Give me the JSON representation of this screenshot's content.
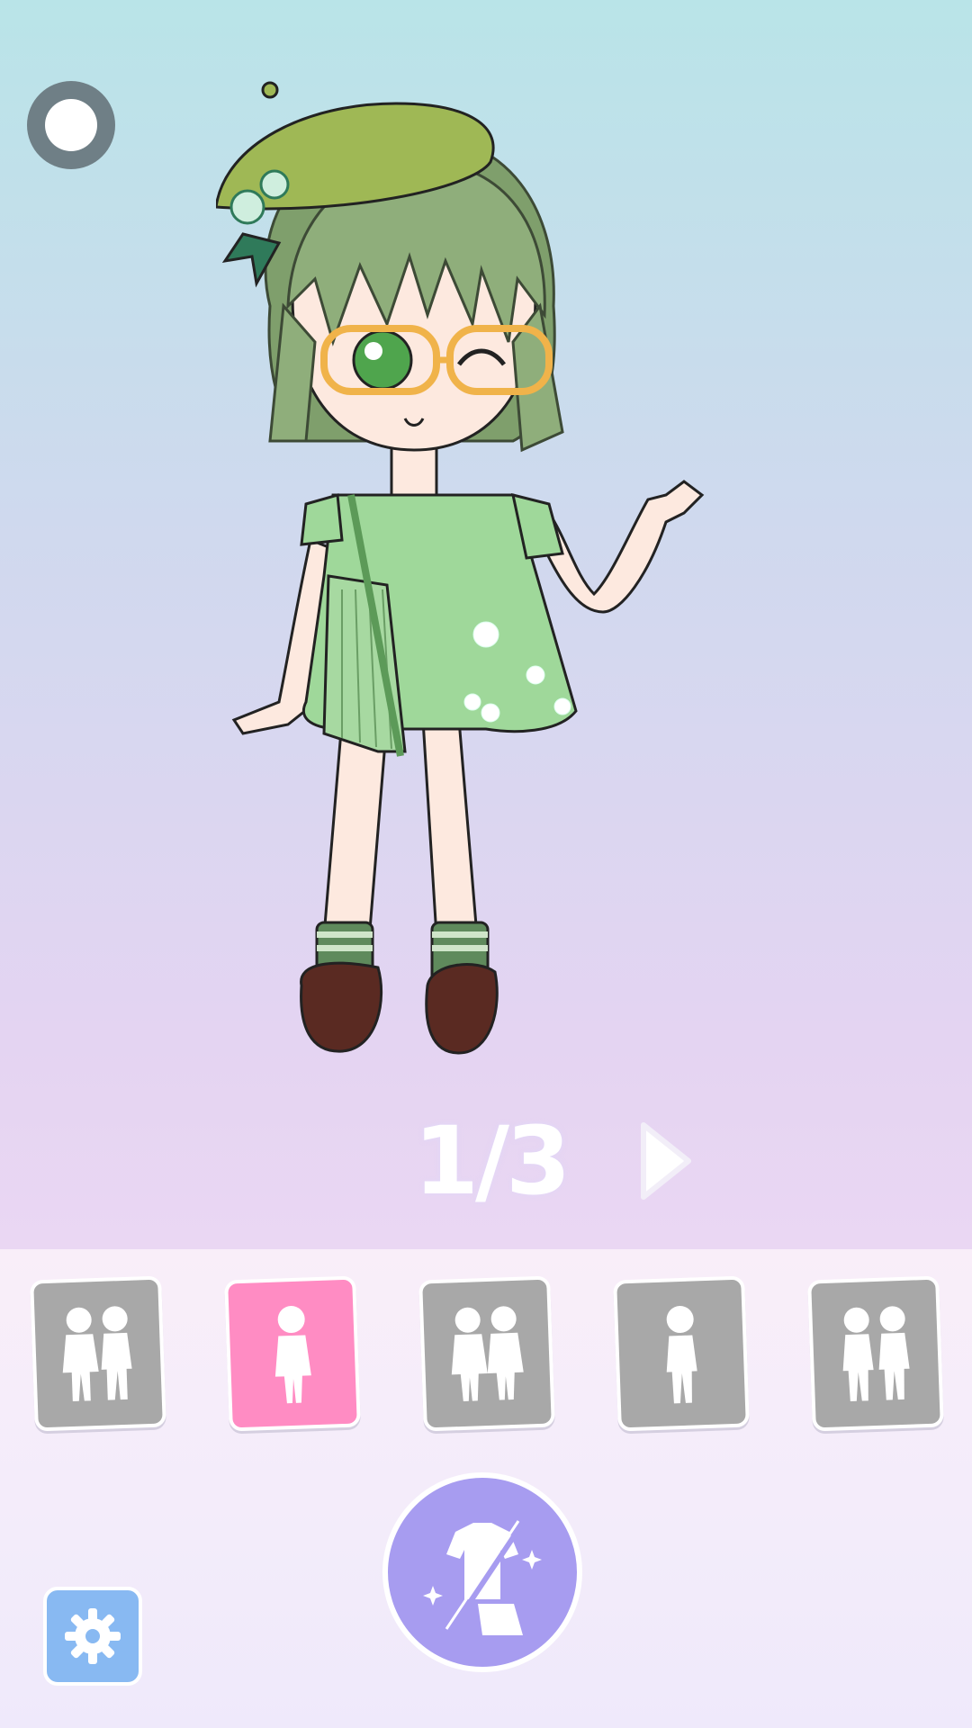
{
  "pager": {
    "text": "1/3",
    "current": 1,
    "total": 3
  },
  "categories": [
    {
      "id": "couple-mixed",
      "icon": "couple-silhouette-icon",
      "active": false
    },
    {
      "id": "single-girl",
      "icon": "girl-silhouette-icon",
      "active": true
    },
    {
      "id": "two-girls",
      "icon": "two-girls-silhouette-icon",
      "active": false
    },
    {
      "id": "single-boy",
      "icon": "boy-silhouette-icon",
      "active": false
    },
    {
      "id": "two-boys",
      "icon": "two-boys-silhouette-icon",
      "active": false
    }
  ],
  "colors": {
    "active_category": "#ff8cc3",
    "inactive_category": "#a8a8a8",
    "wardrobe_button": "#a79cf0",
    "settings_button": "#88b9f2",
    "top_button": "#6f7f86"
  },
  "icons": {
    "top_button": "record-circle-icon",
    "next": "play-arrow-icon",
    "wardrobe": "outfit-swap-icon",
    "settings": "gear-icon"
  }
}
